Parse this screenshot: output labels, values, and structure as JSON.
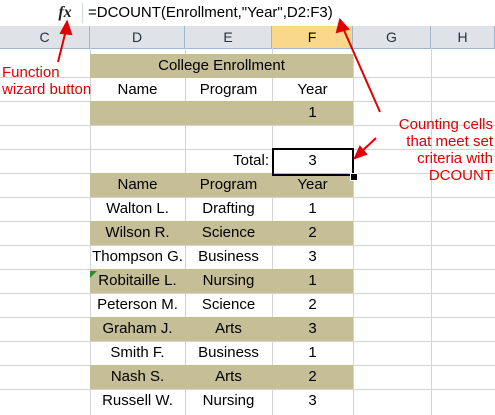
{
  "formula_bar": {
    "fx_label": "fx",
    "formula": "=DCOUNT(Enrollment,\"Year\",D2:F3)"
  },
  "columns": [
    "C",
    "D",
    "E",
    "F",
    "G",
    "H"
  ],
  "active_column": "F",
  "criteria": {
    "title": "College Enrollment",
    "headers": [
      "Name",
      "Program",
      "Year"
    ],
    "values": [
      "",
      "",
      "1"
    ]
  },
  "total": {
    "label": "Total:",
    "value": "3"
  },
  "table": {
    "headers": [
      "Name",
      "Program",
      "Year"
    ],
    "rows": [
      [
        "Walton L.",
        "Drafting",
        "1"
      ],
      [
        "Wilson R.",
        "Science",
        "2"
      ],
      [
        "Thompson G.",
        "Business",
        "3"
      ],
      [
        "Robitaille L.",
        "Nursing",
        "1"
      ],
      [
        "Peterson M.",
        "Science",
        "2"
      ],
      [
        "Graham J.",
        "Arts",
        "3"
      ],
      [
        "Smith F.",
        "Business",
        "1"
      ],
      [
        "Nash S.",
        "Arts",
        "2"
      ],
      [
        "Russell W.",
        "Nursing",
        "3"
      ]
    ]
  },
  "annotations": {
    "fx_button_line1": "Function",
    "fx_button_line2": "wizard button",
    "dcount_line1": "Counting cells",
    "dcount_line2": "that meet set",
    "dcount_line3": "criteria with",
    "dcount_line4": "DCOUNT"
  },
  "colors": {
    "band": "#c5be97",
    "annotation": "#e00000",
    "active_column_header": "#f9d78b"
  }
}
